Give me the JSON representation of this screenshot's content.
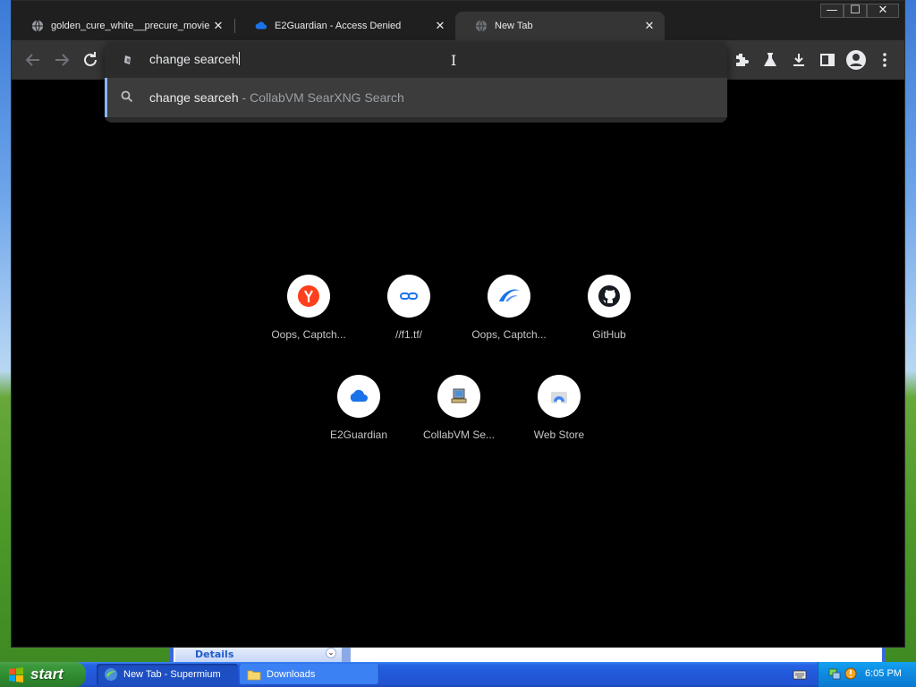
{
  "browser": {
    "tabs": [
      {
        "title": "golden_cure_white__precure_movie",
        "favicon": "globe-icon",
        "active": false
      },
      {
        "title": "E2Guardian - Access Denied",
        "favicon": "cloud-icon",
        "active": false
      },
      {
        "title": "New Tab",
        "favicon": "globe-icon",
        "active": true
      }
    ],
    "window_controls": {
      "minimize": "—",
      "maximize": "☐",
      "close": "✕"
    },
    "toolbar": {
      "back_icon": "arrow-left-icon",
      "forward_icon": "arrow-right-icon",
      "reload_icon": "reload-icon",
      "right_icons": [
        "extensions-icon",
        "labs-flask-icon",
        "download-icon",
        "side-panel-icon",
        "profile-icon",
        "menu-icon"
      ]
    },
    "omnibox": {
      "value": "change searceh",
      "suggestion": {
        "query": "change searceh",
        "suffix": " - CollabVM SearXNG Search"
      }
    }
  },
  "shortcuts": [
    {
      "label": "Oops, Captch...",
      "icon": "yandex-icon"
    },
    {
      "label": "//f1.tf/",
      "icon": "link-icon"
    },
    {
      "label": "Oops, Captch...",
      "icon": "swoosh-icon"
    },
    {
      "label": "GitHub",
      "icon": "github-icon"
    },
    {
      "label": "E2Guardian",
      "icon": "cloud-icon"
    },
    {
      "label": "CollabVM Se...",
      "icon": "computer-icon"
    },
    {
      "label": "Web Store",
      "icon": "web-store-icon"
    }
  ],
  "explorer": {
    "details_label": "Details"
  },
  "taskbar": {
    "start_label": "start",
    "tasks": [
      {
        "label": "New Tab - Supermium",
        "icon": "browser-icon",
        "active": true
      },
      {
        "label": "Downloads",
        "icon": "folder-icon",
        "active": false
      }
    ],
    "clock": "6:05 PM"
  },
  "colors": {
    "accent": "#8ab4f8",
    "tab_active": "#353535",
    "ntp_background": "#000000",
    "xp_taskbar": "#2258da",
    "xp_start": "#2e8a2e"
  }
}
